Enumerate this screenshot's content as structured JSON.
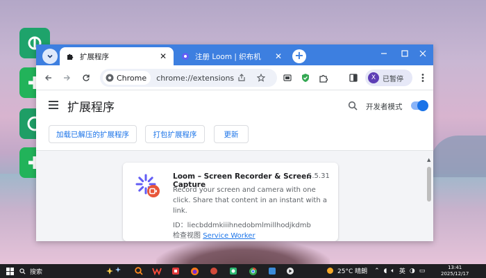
{
  "browser": {
    "tabs": [
      {
        "title": "扩展程序",
        "active": true,
        "icon": "puzzle-icon"
      },
      {
        "title": "注册 Loom | 织布机",
        "active": false,
        "icon": "loom-icon"
      }
    ],
    "omnibox": {
      "chip": "Chrome",
      "url": "chrome://extensions"
    },
    "profile": {
      "initial": "X",
      "label": "已暂停"
    }
  },
  "page": {
    "title": "扩展程序",
    "developer_mode_label": "开发者模式",
    "developer_mode_on": true,
    "buttons": {
      "load_unpacked": "加载已解压的扩展程序",
      "pack": "打包扩展程序",
      "update": "更新"
    }
  },
  "extension": {
    "name": "Loom – Screen Recorder & Screen Capture",
    "version": "5.5.31",
    "description": "Record your screen and camera with one click. Share that content in an instant with a link.",
    "id_label": "ID：liecbddmkiiihnedobmlmillhodjkdmb",
    "inspect_label": "检查视图",
    "inspect_link": "Service Worker"
  },
  "taskbar": {
    "search_label": "搜索",
    "weather": "25°C 晴朗",
    "ime": "英",
    "time": "13:41",
    "date": "2025/12/17"
  },
  "colors": {
    "accent": "#1a73e8",
    "tabbar": "#3d7fe0",
    "loom": "#625df5",
    "loom_badge": "#e8563a"
  }
}
